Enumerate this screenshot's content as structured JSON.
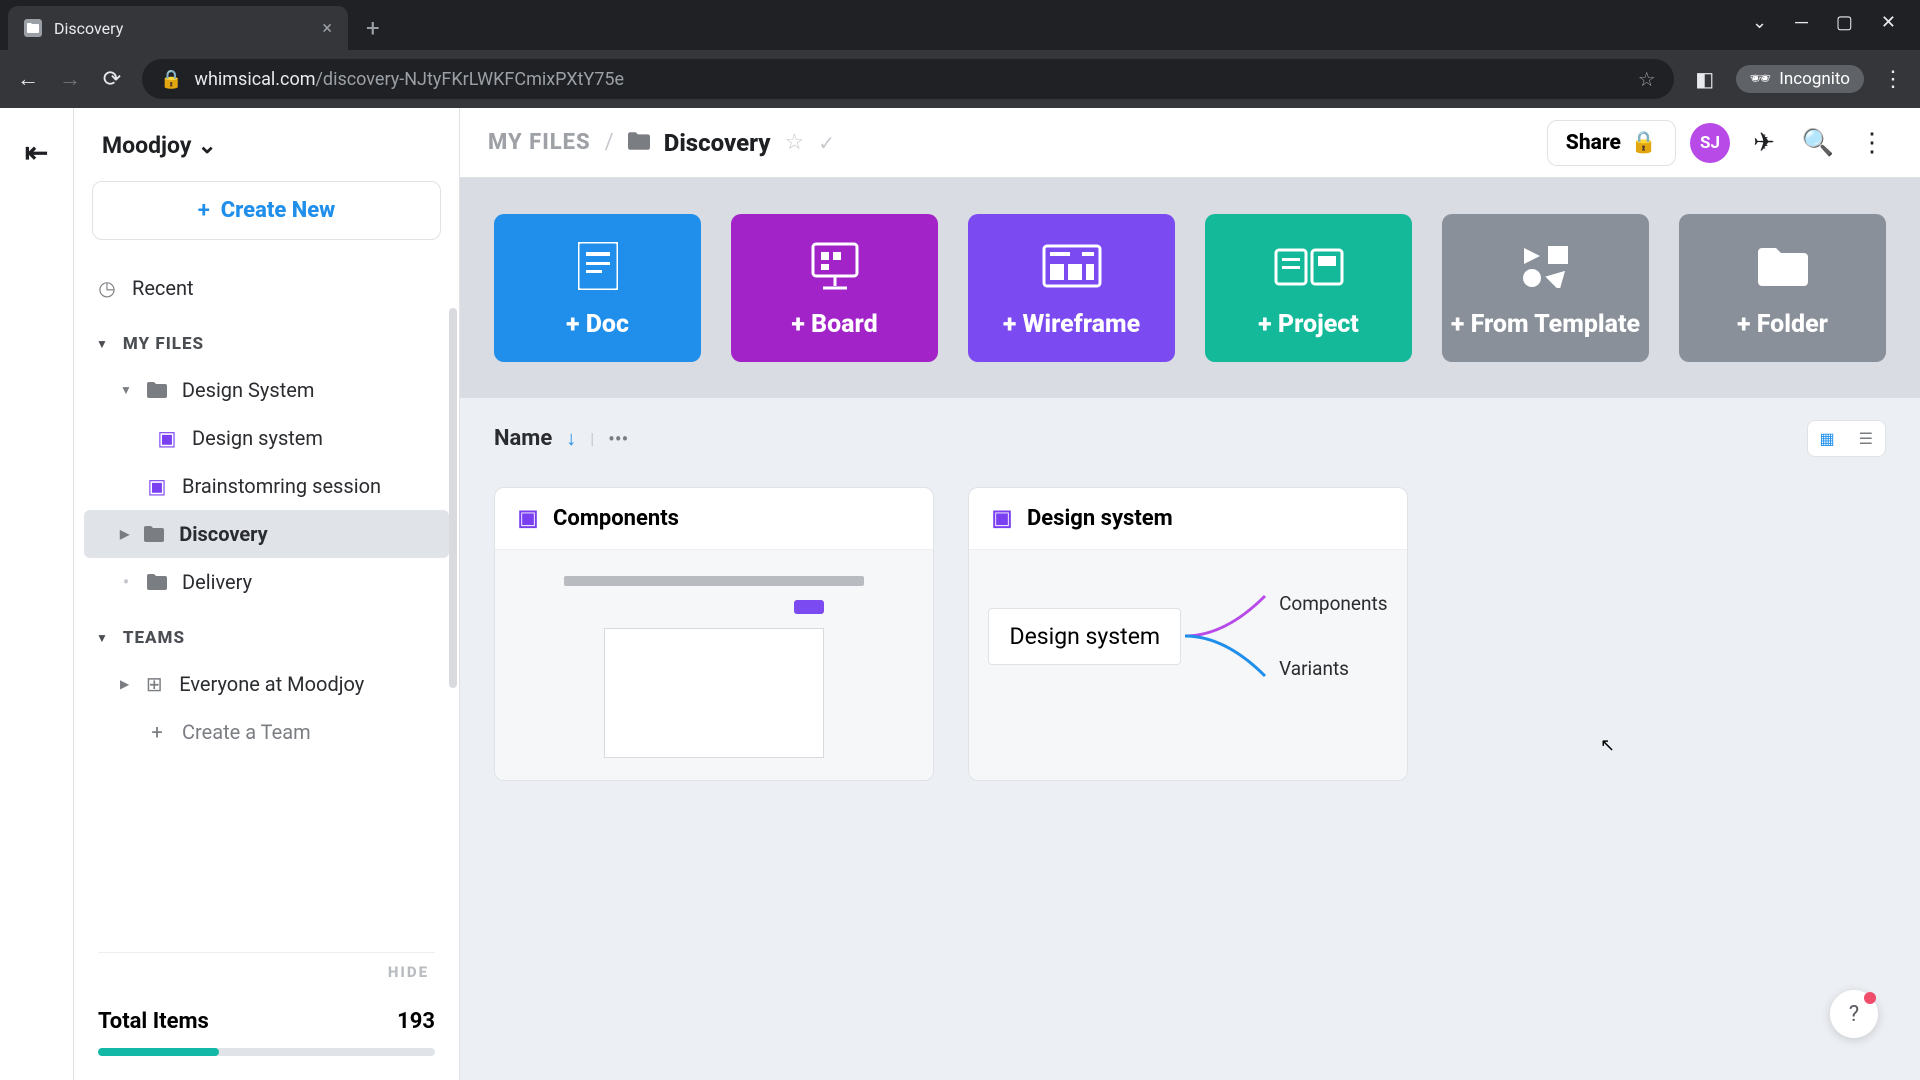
{
  "browser": {
    "tab_title": "Discovery",
    "url_domain": "whimsical.com",
    "url_path": "/discovery-NJtyFKrLWKFCmixPXtY75e",
    "incognito_label": "Incognito"
  },
  "sidebar": {
    "workspace": "Moodjoy",
    "create_new": "Create New",
    "recent": "Recent",
    "my_files_header": "MY FILES",
    "items": [
      {
        "label": "Design System",
        "type": "folder"
      },
      {
        "label": "Design system",
        "type": "board"
      },
      {
        "label": "Brainstomring session",
        "type": "board"
      },
      {
        "label": "Discovery",
        "type": "folder",
        "selected": true
      },
      {
        "label": "Delivery",
        "type": "folder"
      }
    ],
    "teams_header": "TEAMS",
    "team_item": "Everyone at Moodjoy",
    "create_team": "Create a Team",
    "hide": "HIDE",
    "total_label": "Total Items",
    "total_value": "193"
  },
  "topbar": {
    "root": "MY FILES",
    "current": "Discovery",
    "share": "Share",
    "avatar": "SJ"
  },
  "quick": {
    "doc": "+ Doc",
    "board": "+ Board",
    "wireframe": "+ Wireframe",
    "project": "+ Project",
    "template": "+ From Template",
    "folder": "+ Folder"
  },
  "sort": {
    "label": "Name"
  },
  "cards": {
    "c1": {
      "title": "Components"
    },
    "c2": {
      "title": "Design system",
      "root": "Design system",
      "branch1": "Components",
      "branch2": "Variants"
    }
  }
}
